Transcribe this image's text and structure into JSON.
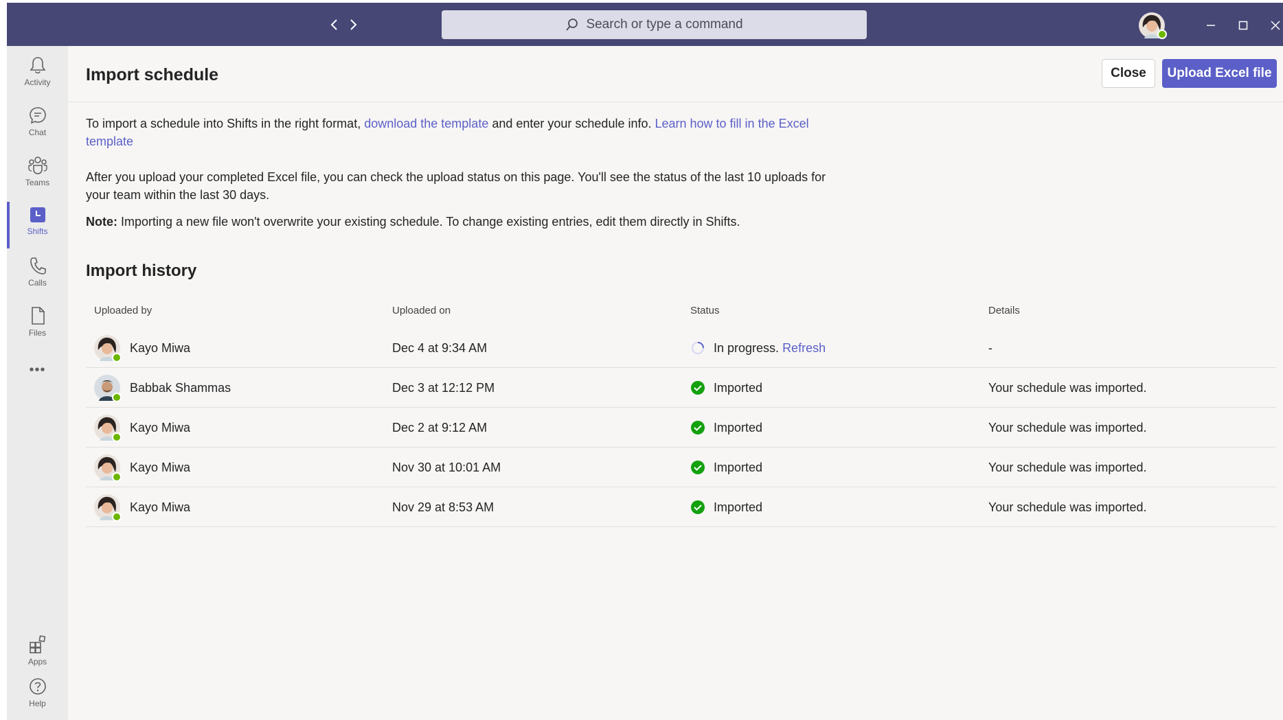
{
  "titlebar": {
    "search_placeholder": "Search or type a command",
    "back_icon": "chevron-left-icon",
    "forward_icon": "chevron-right-icon",
    "accent": "#464775"
  },
  "rail": {
    "items": [
      {
        "label": "Activity",
        "icon": "bell-icon"
      },
      {
        "label": "Chat",
        "icon": "chat-icon"
      },
      {
        "label": "Teams",
        "icon": "teams-icon"
      },
      {
        "label": "Shifts",
        "icon": "shifts-icon",
        "active": true
      },
      {
        "label": "Calls",
        "icon": "phone-icon"
      },
      {
        "label": "Files",
        "icon": "file-icon"
      }
    ],
    "more_label": "•••",
    "bottom_items": [
      {
        "label": "Apps",
        "icon": "apps-icon"
      },
      {
        "label": "Help",
        "icon": "help-icon"
      }
    ]
  },
  "header": {
    "title": "Import schedule",
    "close_label": "Close",
    "upload_label": "Upload Excel file",
    "primary_color": "#5b5fc7"
  },
  "intro": {
    "p1_a": "To import a schedule into Shifts in the right format, ",
    "p1_link1": "download the template",
    "p1_b": " and enter your schedule info. ",
    "p1_link2": "Learn how to fill in the Excel template",
    "p2": "After you upload your completed Excel file, you can check the upload status on this page. You'll see the status of the last 10 uploads for your team within the last 30 days.",
    "note_label": "Note:",
    "note_text": " Importing a new file won't overwrite your existing schedule. To change existing entries, edit them directly in Shifts."
  },
  "history": {
    "title": "Import history",
    "columns": [
      "Uploaded by",
      "Uploaded on",
      "Status",
      "Details"
    ],
    "rows": [
      {
        "user": "Kayo Miwa",
        "date": "Dec 4 at 9:34 AM",
        "status": "In progress.",
        "status_link": "Refresh",
        "status_type": "progress",
        "details": "-"
      },
      {
        "user": "Babbak Shammas",
        "date": "Dec 3 at 12:12 PM",
        "status": "Imported",
        "status_type": "done",
        "details": "Your schedule was imported."
      },
      {
        "user": "Kayo Miwa",
        "date": "Dec 2 at 9:12 AM",
        "status": "Imported",
        "status_type": "done",
        "details": "Your schedule was imported."
      },
      {
        "user": "Kayo Miwa",
        "date": "Nov 30 at 10:01 AM",
        "status": "Imported",
        "status_type": "done",
        "details": "Your schedule was imported."
      },
      {
        "user": "Kayo Miwa",
        "date": "Nov 29 at 8:53 AM",
        "status": "Imported",
        "status_type": "done",
        "details": "Your schedule was imported."
      }
    ],
    "success_color": "#13a10e",
    "presence_color": "#6bb700"
  }
}
